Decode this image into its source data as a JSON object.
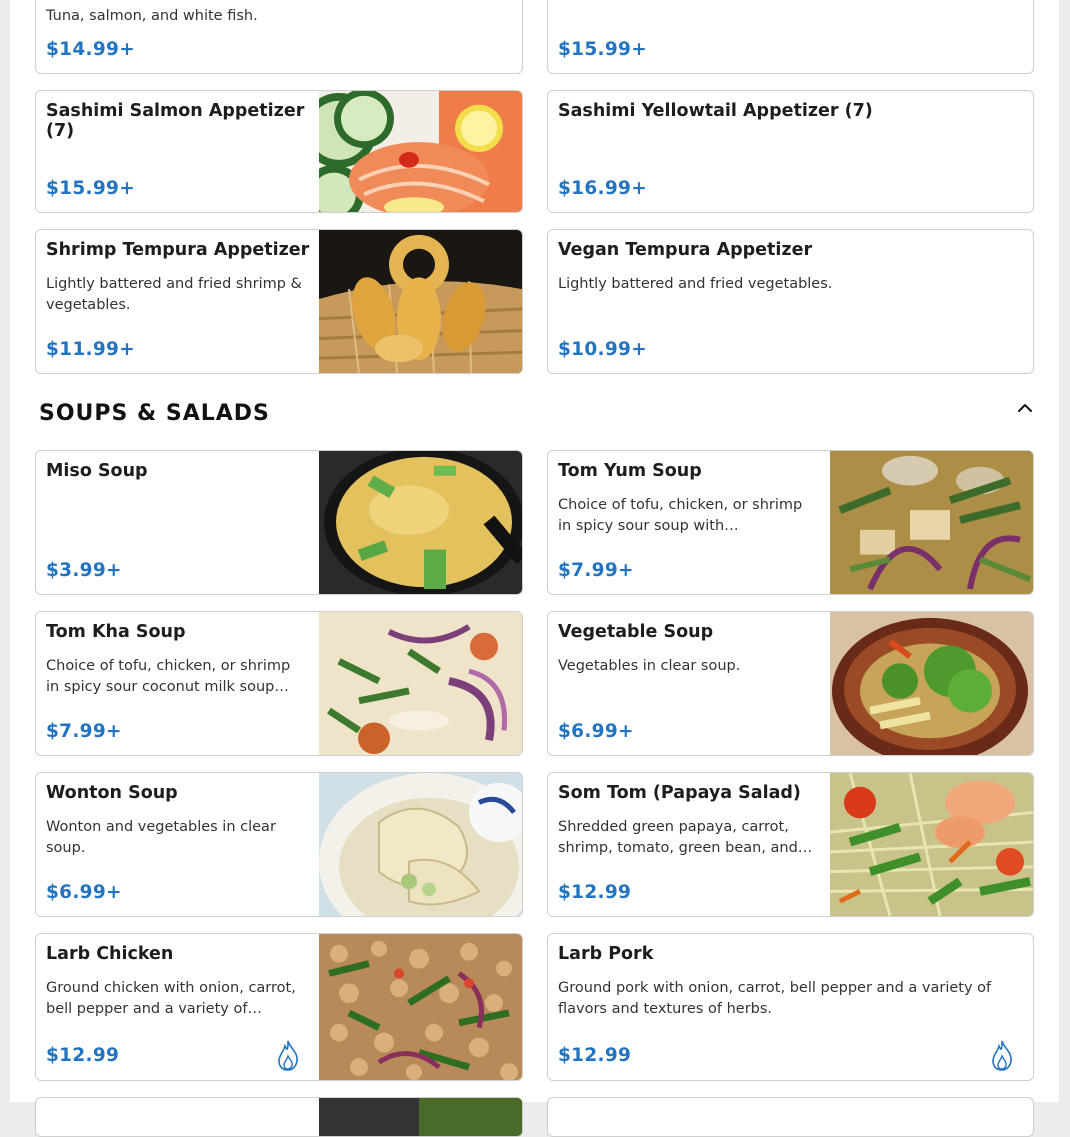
{
  "sections": {
    "soups_title": "SOUPS & SALADS"
  },
  "items": {
    "top_left": {
      "desc": "Tuna, salmon, and white fish.",
      "price": "$14.99+"
    },
    "top_right": {
      "price": "$15.99+"
    },
    "sashimi_salmon": {
      "name": "Sashimi Salmon Appetizer (7)",
      "price": "$15.99+"
    },
    "sashimi_yellowtail": {
      "name": "Sashimi Yellowtail Appetizer (7)",
      "price": "$16.99+"
    },
    "shrimp_tempura": {
      "name": "Shrimp Tempura Appetizer",
      "desc": "Lightly battered and fried shrimp & vegetables.",
      "price": "$11.99+"
    },
    "vegan_tempura": {
      "name": "Vegan Tempura Appetizer",
      "desc": "Lightly battered and fried vegetables.",
      "price": "$10.99+"
    },
    "miso_soup": {
      "name": "Miso Soup",
      "price": "$3.99+"
    },
    "tom_yum": {
      "name": "Tom Yum Soup",
      "desc": "Choice of tofu, chicken, or shrimp in spicy sour soup with mushrooms,…",
      "price": "$7.99+"
    },
    "tom_kha": {
      "name": "Tom Kha Soup",
      "desc": "Choice of tofu, chicken, or shrimp in spicy sour coconut milk soup with…",
      "price": "$7.99+"
    },
    "vegetable_soup": {
      "name": "Vegetable Soup",
      "desc": "Vegetables in clear soup.",
      "price": "$6.99+"
    },
    "wonton_soup": {
      "name": "Wonton Soup",
      "desc": "Wonton and vegetables in clear soup.",
      "price": "$6.99+"
    },
    "som_tom": {
      "name": "Som Tom (Papaya Salad)",
      "desc": "Shredded green papaya, carrot, shrimp, tomato, green bean, and…",
      "price": "$12.99"
    },
    "larb_chicken": {
      "name": "Larb Chicken",
      "desc": "Ground chicken with onion, carrot, bell pepper and a variety of flavors…",
      "price": "$12.99"
    },
    "larb_pork": {
      "name": "Larb Pork",
      "desc": "Ground pork with onion, carrot, bell pepper and a variety of flavors and textures of herbs.",
      "price": "$12.99"
    }
  },
  "icons": {
    "collapse": "chevron-up-icon",
    "spicy": "flame-icon"
  },
  "colors": {
    "price": "#2273c0",
    "spicy": "#2273c0"
  }
}
